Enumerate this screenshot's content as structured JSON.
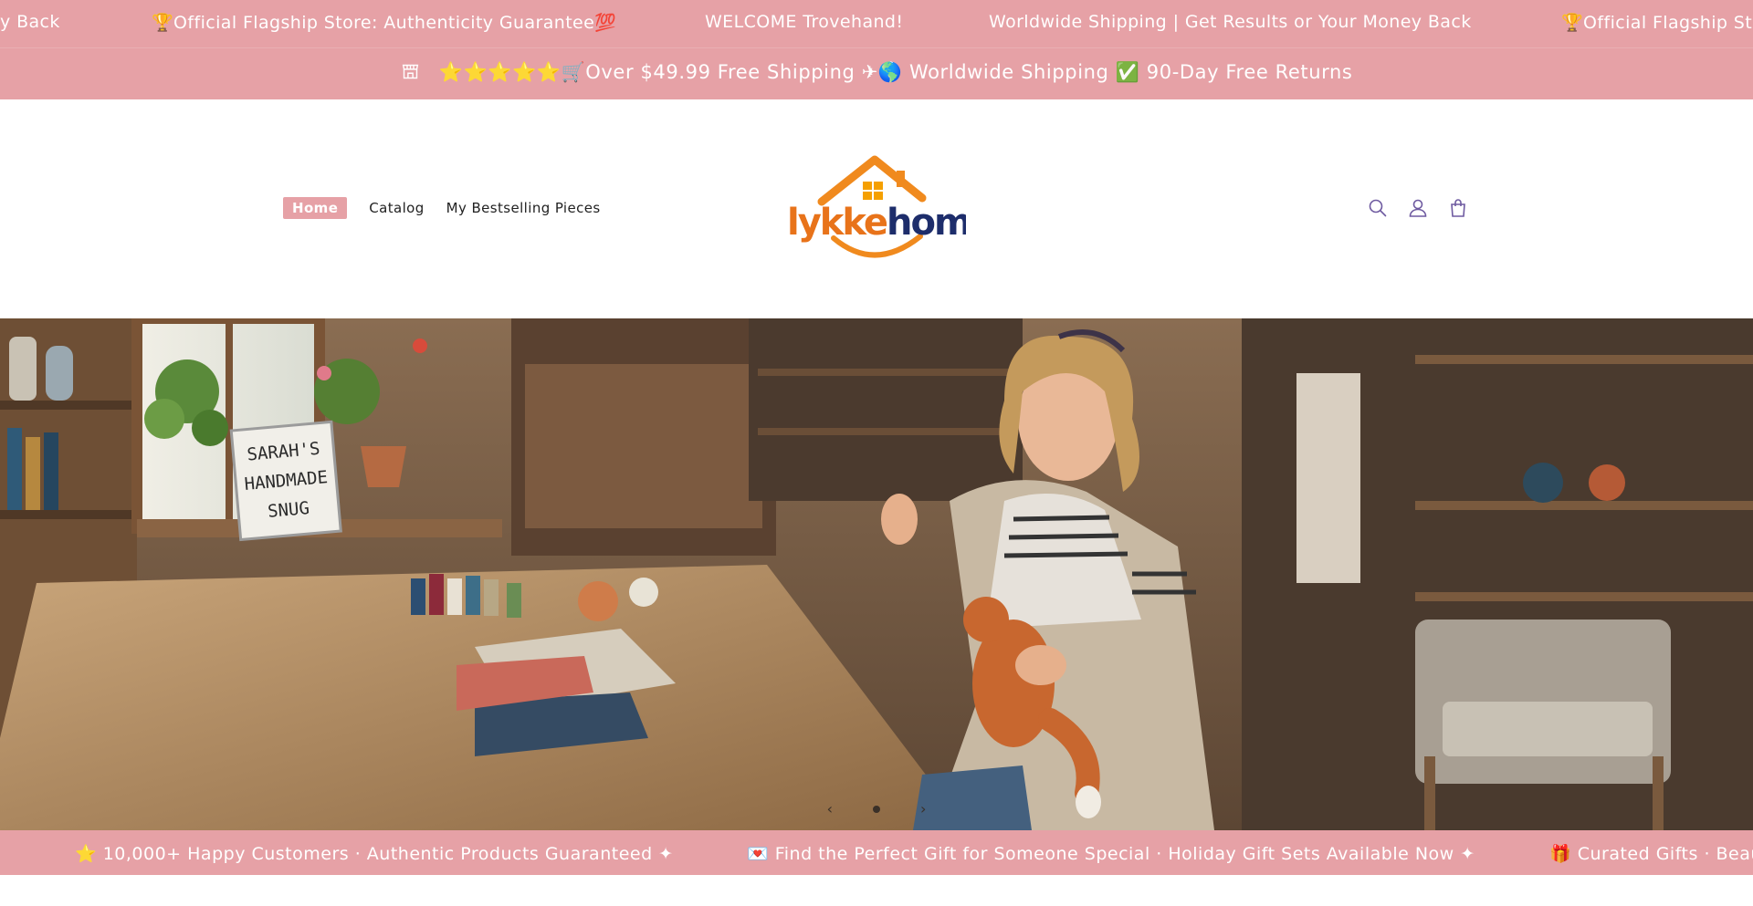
{
  "announcement_top": {
    "messages": [
      "y Back",
      "🏆Official Flagship Store: Authenticity Guarantee💯",
      "WELCOME Trovehand!",
      "Worldwide Shipping | Get Results or Your Money Back",
      "🏆Official Flagship St"
    ]
  },
  "announcement_second": {
    "icon": "store-icon",
    "text": "⭐⭐⭐⭐⭐🛒Over $49.99 Free Shipping ✈🌎 Worldwide Shipping ✅ 90-Day Free Returns"
  },
  "header": {
    "nav": [
      {
        "label": "Home",
        "active": true
      },
      {
        "label": "Catalog",
        "active": false
      },
      {
        "label": "My Bestselling Pieces",
        "active": false
      }
    ],
    "logo": {
      "text_part1": "lykke",
      "text_part2": "home",
      "color_part1": "#e8731a",
      "color_part2": "#1d2d6b"
    },
    "icons": [
      "search-icon",
      "account-icon",
      "cart-icon"
    ]
  },
  "hero": {
    "sign_lines": [
      "SARAH'S",
      "HANDMADE",
      "SNUG"
    ],
    "carousel": {
      "prev": "‹",
      "next": "›"
    }
  },
  "announcement_bottom": {
    "messages": [
      "⭐ 10,000+ Happy Customers · Authentic Products Guaranteed ✦",
      "💌 Find the Perfect Gift for Someone Special · Holiday Gift Sets Available Now ✦",
      "🎁 Curated Gifts · Beau"
    ]
  },
  "colors": {
    "accent": "#e6a1a6",
    "logo_orange": "#e8731a",
    "logo_navy": "#1d2d6b"
  }
}
